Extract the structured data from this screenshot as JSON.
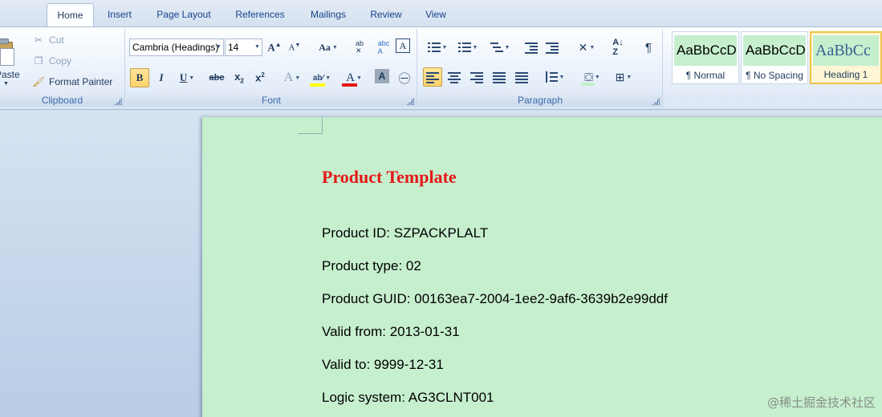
{
  "tabs": [
    "Home",
    "Insert",
    "Page Layout",
    "References",
    "Mailings",
    "Review",
    "View"
  ],
  "clipboard": {
    "paste_label": "Paste",
    "cut_label": "Cut",
    "copy_label": "Copy",
    "format_painter_label": "Format Painter",
    "group_label": "Clipboard"
  },
  "font": {
    "family_value": "Cambria (Headings)",
    "size_value": "14",
    "group_label": "Font",
    "highlight_color": "#ffff00",
    "font_color": "#e51717"
  },
  "paragraph": {
    "group_label": "Paragraph"
  },
  "styles": {
    "items": [
      {
        "sample": "AaBbCcDd",
        "name": "¶ Normal"
      },
      {
        "sample": "AaBbCcDd",
        "name": "¶ No Spacing"
      },
      {
        "sample": "AaBbCc",
        "name": "Heading 1"
      }
    ],
    "selected_color": "#f0c24a"
  },
  "document": {
    "page_color": "#c6efce",
    "heading": "Product Template",
    "heading_color": "#e51717",
    "lines": [
      "Product ID: SZPACKPLALT",
      "Product type: 02",
      "Product GUID: 00163ea7-2004-1ee2-9af6-3639b2e99ddf",
      "Valid from: 2013-01-31",
      "Valid to: 9999-12-31",
      "Logic system: AG3CLNT001"
    ]
  },
  "watermark": "@稀土掘金技术社区"
}
